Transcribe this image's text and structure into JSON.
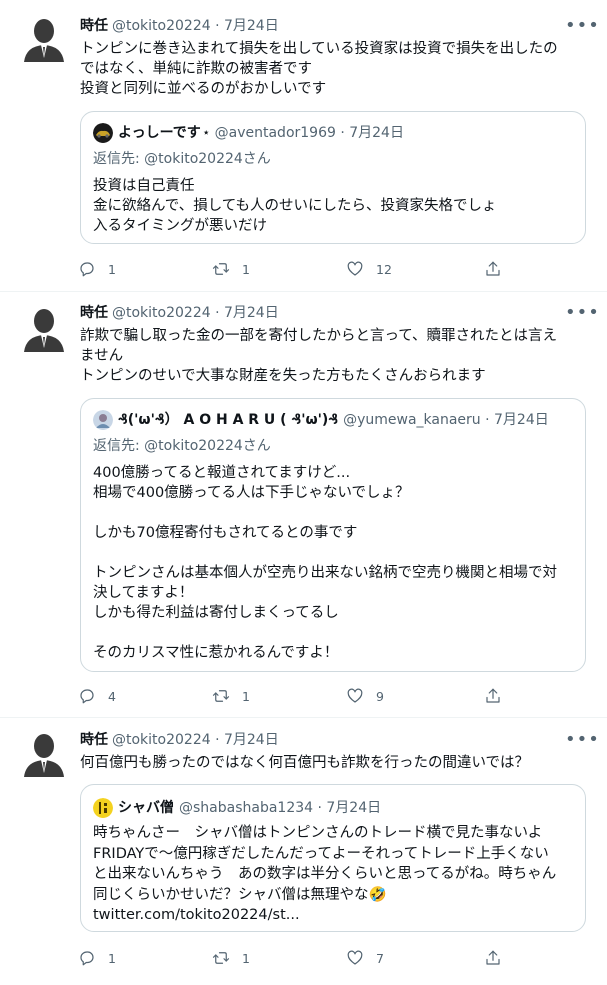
{
  "tweets": [
    {
      "author_name": "時任",
      "meta": "@tokito20224 · 7月24日",
      "text": "トンピンに巻き込まれて損失を出している投資家は投資で損失を出したの\nではなく、単純に詐欺の被害者です\n投資と同列に並べるのがおかしいです",
      "quote": {
        "name": "よっしーです",
        "name_suffix": "⋆",
        "meta": "@aventador1969 · 7月24日",
        "reply_to": "返信先: @tokito20224さん",
        "text": "投資は自己責任\n金に欲絡んで、損しても人のせいにしたら、投資家失格でしょ\n入るタイミングが悪いだけ"
      },
      "reply_count": "1",
      "retweet_count": "1",
      "like_count": "12"
    },
    {
      "author_name": "時任",
      "meta": "@tokito20224 · 7月24日",
      "text": "詐欺で騙し取った金の一部を寄付したからと言って、贖罪されたとは言え\nません\nトンピンのせいで大事な財産を失った方もたくさんおられます",
      "quote": {
        "name": "₰('ω'₰） A O H A R U ( ₰'ω')₰",
        "name_suffix": "",
        "meta": "@yumewa_kanaeru · 7月24日",
        "reply_to": "返信先: @tokito20224さん",
        "text": "400億勝ってると報道されてますけど...\n相場で400億勝ってる人は下手じゃないでしょ？\n\nしかも70億程寄付もされてるとの事です\n\nトンピンさんは基本個人が空売り出来ない銘柄で空売り機関と相場で対\n決してますよ！\nしかも得た利益は寄付しまくってるし\n\nそのカリスマ性に惹かれるんですよ！"
      },
      "reply_count": "4",
      "retweet_count": "1",
      "like_count": "9"
    },
    {
      "author_name": "時任",
      "meta": "@tokito20224 · 7月24日",
      "text": "何百億円も勝ったのではなく何百億円も詐欺を行ったの間違いでは？",
      "quote": {
        "name": "シャバ僧",
        "name_suffix": "",
        "meta": "@shabashaba1234 · 7月24日",
        "reply_to": "",
        "text": "時ちゃんさー　シャバ僧はトンピンさんのトレード横で見た事ないよ\nFRIDAYで〜億円稼ぎだしたんだってよーそれってトレード上手くない\nと出来ないんちゃう　あの数字は半分くらいと思ってるがね。時ちゃん\n同じくらいかせいだ？シャバ僧は無理やな🤣\ntwitter.com/tokito20224/st..."
      },
      "reply_count": "1",
      "retweet_count": "1",
      "like_count": "7"
    }
  ],
  "more_glyph": "•••",
  "icons": {
    "reply": "reply-icon",
    "retweet": "retweet-icon",
    "like": "heart-icon",
    "share": "share-icon",
    "more": "more-icon"
  },
  "colors": {
    "text": "#0f1419",
    "secondary": "#536471",
    "border": "#cfd9de",
    "divider": "#eff3f4"
  }
}
